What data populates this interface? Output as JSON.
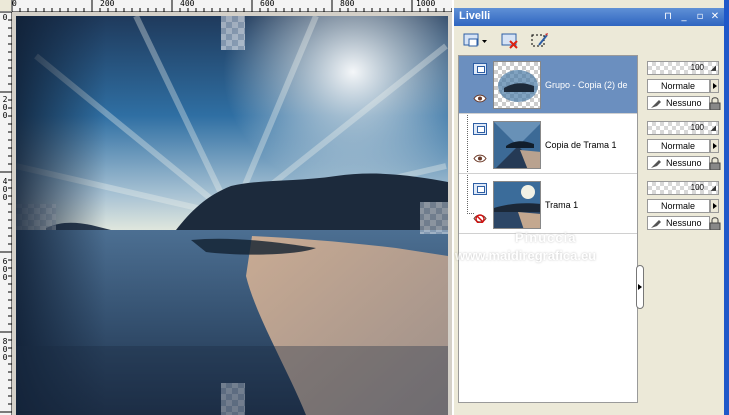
{
  "ruler": {
    "top_labels": [
      "0",
      "200",
      "400",
      "600",
      "800",
      "1000"
    ],
    "left_labels": [
      "0",
      "200",
      "400",
      "600",
      "800"
    ]
  },
  "palette": {
    "title": "Livelli",
    "window_buttons": {
      "pin": "⊓",
      "minimize": "_",
      "restore": "▫",
      "close": "✕"
    }
  },
  "toolbar": {
    "icons": [
      "new-layer-icon",
      "delete-layer-icon",
      "edit-selection-icon"
    ]
  },
  "layers": [
    {
      "name": "Grupo - Copia (2) de",
      "selected": true,
      "visible": true,
      "opacity": "100",
      "blend": "Normale",
      "mask": "Nessuno",
      "thumb": "group"
    },
    {
      "name": "Copia de Trama 1",
      "selected": false,
      "visible": true,
      "opacity": "100",
      "blend": "Normale",
      "mask": "Nessuno",
      "thumb": "copy"
    },
    {
      "name": "Trama 1",
      "selected": false,
      "visible": false,
      "opacity": "100",
      "blend": "Normale",
      "mask": "Nessuno",
      "thumb": "base"
    }
  ],
  "watermark": {
    "line1": "Pinuccia",
    "line2": "www.maidiregrafica.eu"
  },
  "colors": {
    "titlebar": "#2f65c0",
    "selected_row": "#6b8fbf",
    "panel": "#ece9d8"
  }
}
